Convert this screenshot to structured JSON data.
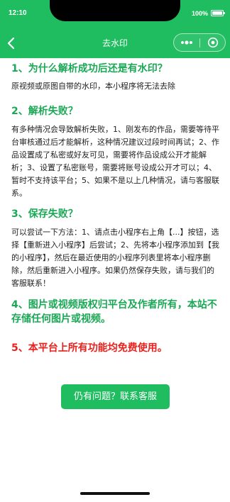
{
  "status_bar": {
    "time": "12:10",
    "battery": "100%"
  },
  "nav": {
    "title": "去水印"
  },
  "sections": [
    {
      "heading": "1、为什么解析成功后还是有水印？",
      "body": "原视频或原图自带的水印，本小程序将无法去除"
    },
    {
      "heading": "2、解析失败？",
      "body": "有多种情况会导致解析失败，1、刚发布的作品，需要等待平台审核通过后才能解析，这种情况建议过段时间再试；2、作品设置成了私密或好友可见，需要将作品设成公开才能解析；3、设置了私密账号，需要将账号设成公开才可以；4、暂时不支持该平台；5、如果不是以上几种情况，请与客服联系。"
    },
    {
      "heading": "3、保存失败？",
      "body": "可以尝试一下方法：1、请点击小程序右上角【...】按钮，选择【重新进入小程序】后尝试；2、先将本小程序添加到【我的小程序】，然后在最近使用的小程序列表里将本小程序删除，然后重新进入小程序。如果仍然保存失败，请与我们的客服联系！"
    },
    {
      "heading": "4、图片或视频版权归平台及作者所有，本站不存储任何图片或视频。"
    },
    {
      "heading": "5、本平台上所有功能均免费使用。"
    }
  ],
  "contact_button": {
    "label": "仍有问题？联系客服"
  },
  "colors": {
    "brand_green": "#1fbd60",
    "heading_green": "#1aa856",
    "warning_red": "#e8211c"
  },
  "icons": {
    "back": "chevron-left-icon",
    "more": "more-dots-icon",
    "close": "capsule-close-icon",
    "battery": "battery-icon"
  }
}
